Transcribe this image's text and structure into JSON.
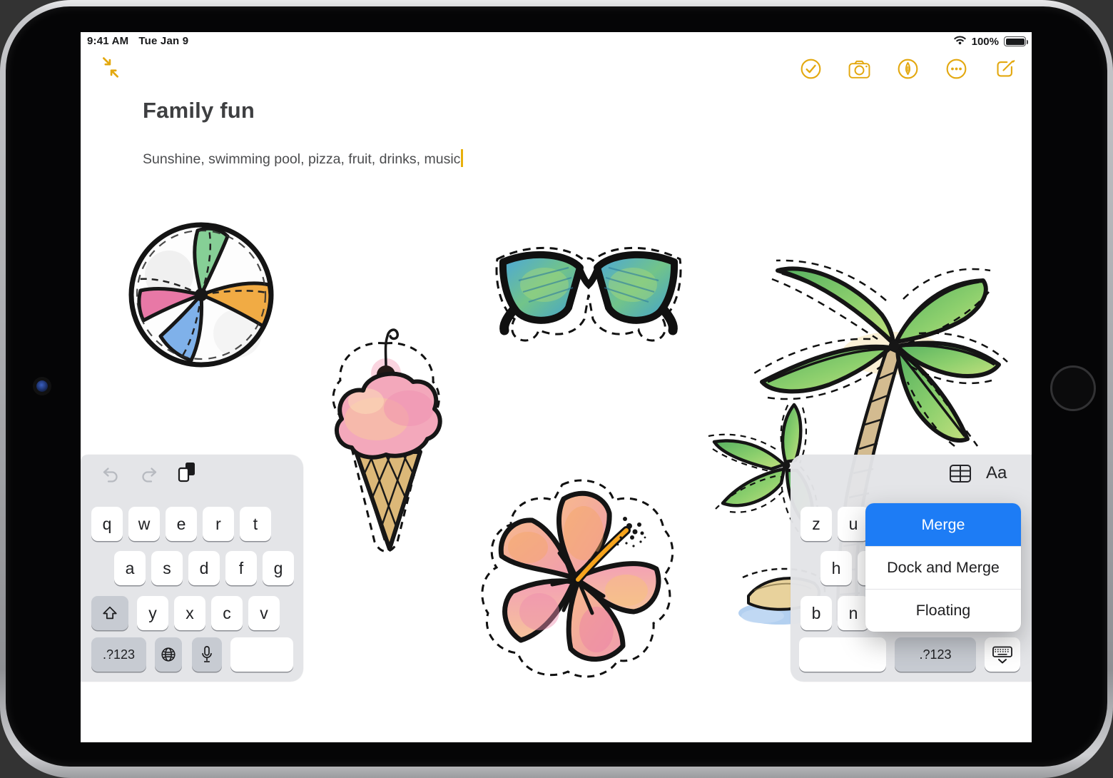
{
  "status_bar": {
    "time": "9:41 AM",
    "date": "Tue Jan 9",
    "battery_percent": "100%",
    "icons": [
      "wifi-icon",
      "battery-icon"
    ]
  },
  "note_header": {
    "collapse_icon": "collapse-note-icon",
    "toolbar_icons": [
      "checklist-icon",
      "camera-icon",
      "markup-icon",
      "more-icon",
      "compose-icon"
    ]
  },
  "note": {
    "title": "Family fun",
    "body": "Sunshine, swimming pool, pizza, fruit, drinks, music"
  },
  "stickers": [
    "beach-ball",
    "ice-cream-cone",
    "sunglasses",
    "hibiscus-flower",
    "palm-tree",
    "small-palm-with-island"
  ],
  "keyboard": {
    "left": {
      "shortcut_icons": [
        "undo-icon",
        "redo-icon",
        "paste-icon"
      ],
      "row1": [
        "q",
        "w",
        "e",
        "r",
        "t"
      ],
      "row2": [
        "a",
        "s",
        "d",
        "f",
        "g"
      ],
      "row3": [
        "y",
        "x",
        "c",
        "v"
      ],
      "numbers_label": ".?123",
      "bottom_icons": [
        "shift-icon",
        "globe-icon",
        "mic-icon"
      ],
      "space_label": ""
    },
    "right": {
      "format_icons": [
        "table-icon"
      ],
      "format_label": "Aa",
      "row1": [
        "z",
        "u"
      ],
      "row2": [
        "h"
      ],
      "row3": [
        "b",
        "n"
      ],
      "numbers_label": ".?123",
      "dismiss_icon": "dismiss-keyboard-icon",
      "space_label": ""
    }
  },
  "popup": {
    "items": [
      "Merge",
      "Dock and Merge",
      "Floating"
    ],
    "selected": "Merge"
  },
  "colors": {
    "accent_gold": "#E3A80F",
    "selection_blue": "#1D7CF5",
    "keyboard_panel": "#E3E4E7",
    "modifier_key": "#C7CBD2",
    "key_white": "#FFFFFF",
    "title_text": "#3E3F41",
    "body_text": "#4B4C4E"
  }
}
